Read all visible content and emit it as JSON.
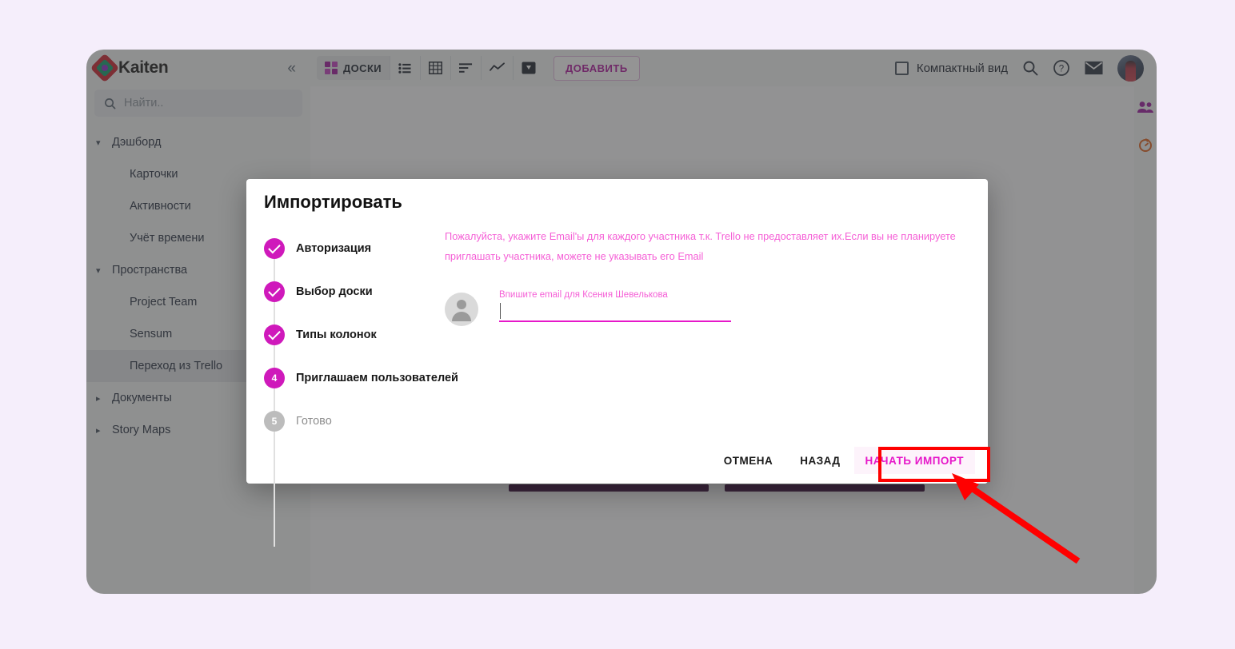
{
  "app": {
    "brand": "Kaiten",
    "collapse_icon": "chevrons-left-icon",
    "search_placeholder": "Найти..",
    "logo_icon": "kaiten-logo-icon"
  },
  "sidebar": {
    "groups": [
      {
        "label": "Дэшборд",
        "expanded": true,
        "chevron": "chevron-down-icon",
        "items": [
          "Карточки",
          "Активности",
          "Учёт времени"
        ]
      },
      {
        "label": "Пространства",
        "expanded": true,
        "chevron": "chevron-down-icon",
        "items": [
          "Project Team",
          "Sensum",
          "Переход из Trello"
        ]
      },
      {
        "label": "Документы",
        "expanded": false,
        "chevron": "chevron-right-icon",
        "items": []
      },
      {
        "label": "Story Maps",
        "expanded": false,
        "chevron": "chevron-right-icon",
        "items": []
      }
    ],
    "active_item": "Переход из Trello"
  },
  "toolbar": {
    "view_buttons": [
      {
        "name": "boards-view",
        "label": "ДОСКИ",
        "icon": "four-squares-icon",
        "active": true
      },
      {
        "name": "list-view",
        "label": "",
        "icon": "list-icon",
        "active": false
      },
      {
        "name": "table-view",
        "label": "",
        "icon": "grid-table-icon",
        "active": false
      },
      {
        "name": "sorted-view",
        "label": "",
        "icon": "sort-bars-icon",
        "active": false
      },
      {
        "name": "chart-view",
        "label": "",
        "icon": "line-chart-icon",
        "active": false
      },
      {
        "name": "card-view",
        "label": "",
        "icon": "filled-card-icon",
        "active": false
      }
    ],
    "add_label": "ДОБАВИТЬ",
    "compact_label": "Компактный вид",
    "compact_checked": false,
    "right_icons": [
      "search-icon",
      "help-circle-icon",
      "mail-icon",
      "avatar"
    ]
  },
  "rail": {
    "icons": [
      "people-icon",
      "timer-icon"
    ],
    "people_color": "#9b18a0",
    "timer_color": "#e1601c"
  },
  "modal": {
    "title": "Импортировать",
    "steps": [
      {
        "num": "1",
        "label": "Авторизация",
        "state": "done"
      },
      {
        "num": "2",
        "label": "Выбор доски",
        "state": "done"
      },
      {
        "num": "3",
        "label": "Типы колонок",
        "state": "done"
      },
      {
        "num": "4",
        "label": "Приглашаем пользователей",
        "state": "current"
      },
      {
        "num": "5",
        "label": "Готово",
        "state": "idle"
      }
    ],
    "hint": "Пожалуйста, укажите Email'ы для каждого участника т.к. Trello не предоставляет их.Если вы не планируете приглашать участника, можете не указывать его Email",
    "person": {
      "avatar_icon": "person-avatar-icon",
      "field_label": "Впишите email для Ксения Шевелькова",
      "field_value": ""
    },
    "actions": {
      "cancel": "ОТМЕНА",
      "back": "НАЗАД",
      "primary": "НАЧАТЬ ИМПОРТ"
    }
  },
  "annotations": {
    "highlight_color": "#ff0000",
    "highlight_target": "НАЧАТЬ ИМПОРТ"
  }
}
